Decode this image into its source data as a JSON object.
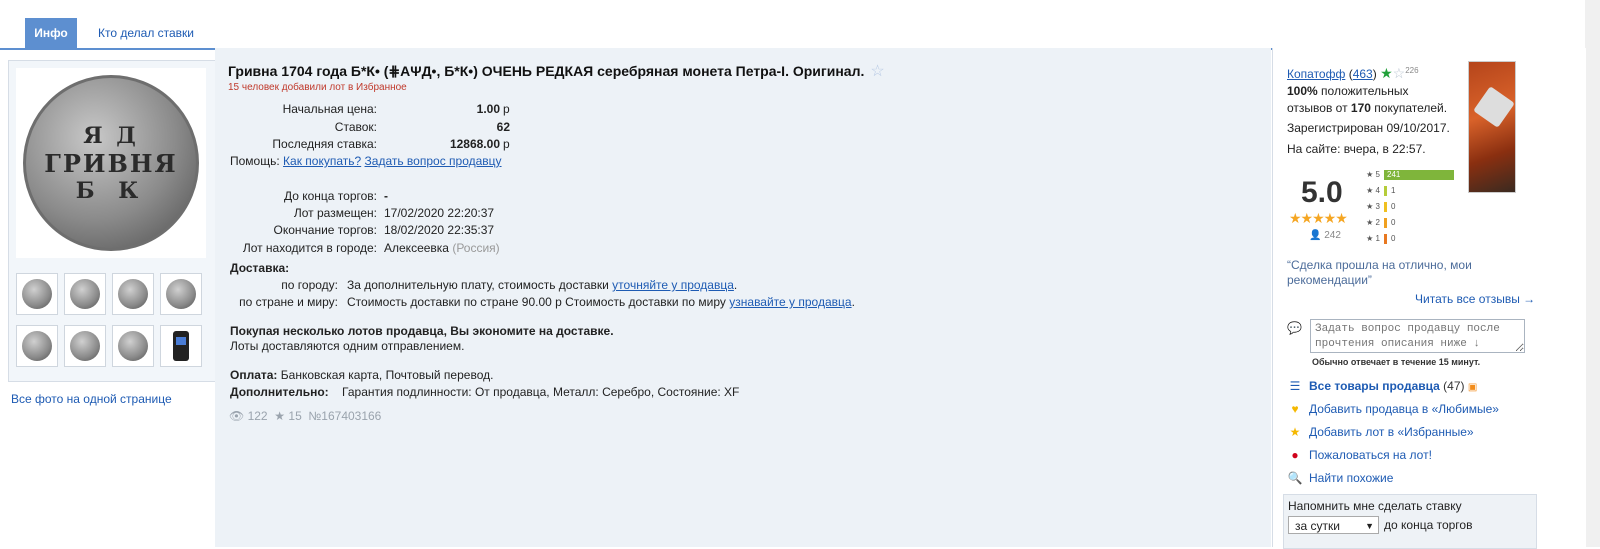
{
  "tabs": {
    "info": "Инфо",
    "bidders": "Кто делал ставки"
  },
  "gallery": {
    "coin_lines": [
      "Я Д",
      "ГРИВНЯ",
      "Б К"
    ],
    "all_photos": "Все фото на одной странице"
  },
  "lot": {
    "title": "Гривна 1704 года Б*К• (⋕АΨД•, Б*К•) ОЧЕНЬ РЕДКАЯ серебряная монета Петра-I. Оригинал.",
    "favorites_note": "15 человек добавили лот в Избранное",
    "start_price_label": "Начальная цена:",
    "start_price": "1.00",
    "start_price_cur": "р",
    "bids_label": "Ставок:",
    "bids": "62",
    "last_bid_label": "Последняя ставка:",
    "last_bid": "12868.00",
    "last_bid_cur": "р",
    "help_label": "Помощь:",
    "help_link1": "Как покупать?",
    "help_link2": "Задать вопрос продавцу",
    "ends_in_label": "До конца торгов:",
    "ends_in": "-",
    "placed_label": "Лот размещен:",
    "placed": "17/02/2020 22:20:37",
    "ended_label": "Окончание торгов:",
    "ended": "18/02/2020 22:35:37",
    "city_label": "Лот находится в городе:",
    "city": "Алексеевка",
    "country": "(Россия)",
    "delivery_label": "Доставка:",
    "city_delivery_label": "по городу:",
    "city_delivery": "За дополнительную плату, стоимость доставки",
    "city_delivery_link": "уточняйте у продавца",
    "world_delivery_label": "по стране и миру:",
    "world_delivery": "Стоимость доставки по стране 90.00 р Стоимость доставки по миру",
    "world_delivery_link": "узнавайте у продавца",
    "multi_title": "Покупая несколько лотов продавца, Вы экономите на доставке.",
    "multi_note": "Лоты доставляются одним отправлением.",
    "payment_label": "Оплата:",
    "payment": "Банковская карта, Почтовый перевод.",
    "extra_label": "Дополнительно:",
    "extra": "Гарантия подлинности: От продавца, Металл: Серебро, Состояние: XF",
    "views": "122",
    "stars": "15",
    "lot_number": "№167403166"
  },
  "seller": {
    "name": "Копатофф",
    "count": "463",
    "count_open": "(",
    "count_close": ")",
    "star_sup": "226",
    "positive_pct": "100%",
    "positive_text": "положительных",
    "reviews_from": "отзывов от",
    "buyers_count": "170",
    "buyers_text": "покупателей.",
    "registered": "Зарегистрирован 09/10/2017.",
    "online": "На сайте: вчера, в 22:57.",
    "score": "5.0",
    "votes": "242",
    "ratings": [
      {
        "star": "5",
        "count": "241",
        "fraction": 1.0,
        "color": "#7fb53b"
      },
      {
        "star": "4",
        "count": "1",
        "fraction": 0.0,
        "color": "#b5cc3a"
      },
      {
        "star": "3",
        "count": "0",
        "fraction": 0.0,
        "color": "#f0c020"
      },
      {
        "star": "2",
        "count": "0",
        "fraction": 0.0,
        "color": "#f0a020"
      },
      {
        "star": "1",
        "count": "0",
        "fraction": 0.0,
        "color": "#e87820"
      }
    ],
    "quote": "“Сделка прошла на отлично, мои рекомендации”",
    "read_all": "Читать все отзывы →",
    "ask_placeholder": "Задать вопрос продавцу после прочтения описания ниже ↓",
    "reply_time": "Обычно отвечает в течение 15 минут.",
    "all_items": "Все товары продавца",
    "all_items_count": "(47)",
    "add_seller_fav": "Добавить продавца в «Любимые»",
    "add_lot_fav": "Добавить лот в «Избранные»",
    "report": "Пожаловаться на лот!",
    "find_similar": "Найти похожие",
    "remind_title": "Напомнить мне сделать ставку",
    "remind_option": "за сутки",
    "remind_after": "до конца торгов"
  },
  "colors": {
    "accent": "#5d8fd0",
    "link": "#1e5bb3",
    "panel": "#edf2f7",
    "fav_red": "#c0392b",
    "green_star": "#22a13a"
  }
}
